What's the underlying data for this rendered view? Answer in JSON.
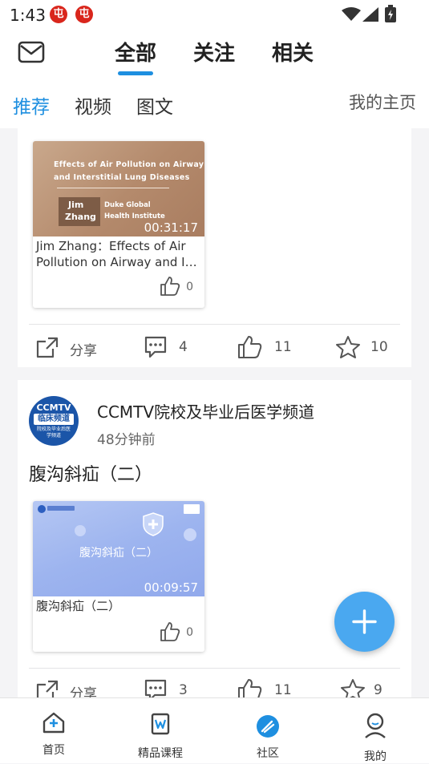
{
  "status_bar": {
    "time": "1:43",
    "app_icon_glyph": "屯"
  },
  "header": {
    "tabs": [
      "全部",
      "关注",
      "相关"
    ],
    "sub_tabs": [
      "推荐",
      "视频",
      "图文"
    ],
    "active_sub_tab": "推荐",
    "home_link": "我的主页"
  },
  "colors": {
    "accent": "#1e8fe0",
    "fab": "#4aa8f0"
  },
  "post1": {
    "thumb": {
      "slide_title_line1": "Effects of Air Pollution on Airway",
      "slide_title_line2": "and Interstitial Lung Diseases",
      "speaker_line1": "Jim",
      "speaker_line2": "Zhang",
      "institute_line1": "Duke Global",
      "institute_line2": "Health Institute",
      "duration": "00:31:17",
      "title_line1": "Jim Zhang：Effects of Air",
      "title_line2": "Pollution on Airway and Int…",
      "likes": "0"
    },
    "actions": {
      "share": "分享",
      "comments": "4",
      "likes": "11",
      "favorites": "10"
    }
  },
  "post2": {
    "author": "CCMTV院校及毕业后医学频道",
    "avatar_text_top": "CCMTV",
    "avatar_text_mid": "临床频道",
    "avatar_text_bottom": "院校及毕业后医学频道",
    "time": "48分钟前",
    "title": "腹沟斜疝（二）",
    "thumb": {
      "slide_title": "腹沟斜疝（二）",
      "duration": "00:09:57",
      "title": "腹沟斜疝（二）",
      "likes": "0"
    },
    "actions": {
      "share": "分享",
      "comments": "3",
      "likes": "11",
      "favorites": "9"
    }
  },
  "bottom_nav": [
    {
      "label": "首页",
      "icon": "home-plus-icon"
    },
    {
      "label": "精品课程",
      "icon": "course-icon"
    },
    {
      "label": "社区",
      "icon": "community-icon"
    },
    {
      "label": "我的",
      "icon": "profile-icon"
    }
  ],
  "active_nav": "社区"
}
